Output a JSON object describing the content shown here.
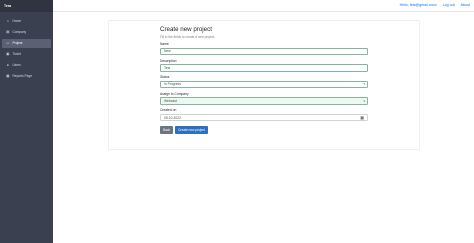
{
  "sidebar": {
    "brand": "Tera",
    "items": [
      {
        "label": "Home",
        "icon": "home-icon",
        "glyph": "▪"
      },
      {
        "label": "Company",
        "icon": "building-icon",
        "glyph": "▪"
      },
      {
        "label": "Project",
        "icon": "folder-icon",
        "glyph": "▪"
      },
      {
        "label": "Ticket",
        "icon": "ticket-icon",
        "glyph": "▪"
      },
      {
        "label": "Users",
        "icon": "users-icon",
        "glyph": "▪"
      },
      {
        "label": "Reports Page",
        "icon": "report-icon",
        "glyph": "▪"
      }
    ],
    "active_index": 2
  },
  "topbar": {
    "greeting": "Hello, test@gmail.com!",
    "logout": "Log out",
    "about": "About"
  },
  "form": {
    "title": "Create new project",
    "subtitle": "Fill in the fields to create a new project.",
    "name_label": "Name",
    "name_value": "New",
    "description_label": "Description",
    "description_value": "Test",
    "status_label": "Status",
    "status_value": "In Progress",
    "company_label": "Assign to Company",
    "company_value": "Webcast",
    "created_label": "Created on",
    "created_value": "05-10-2022",
    "back_label": "Back",
    "create_label": "Create new project"
  },
  "colors": {
    "sidebar": "#3a4050",
    "accent": "#2f6fc0",
    "valid_border": "#86b59d"
  }
}
